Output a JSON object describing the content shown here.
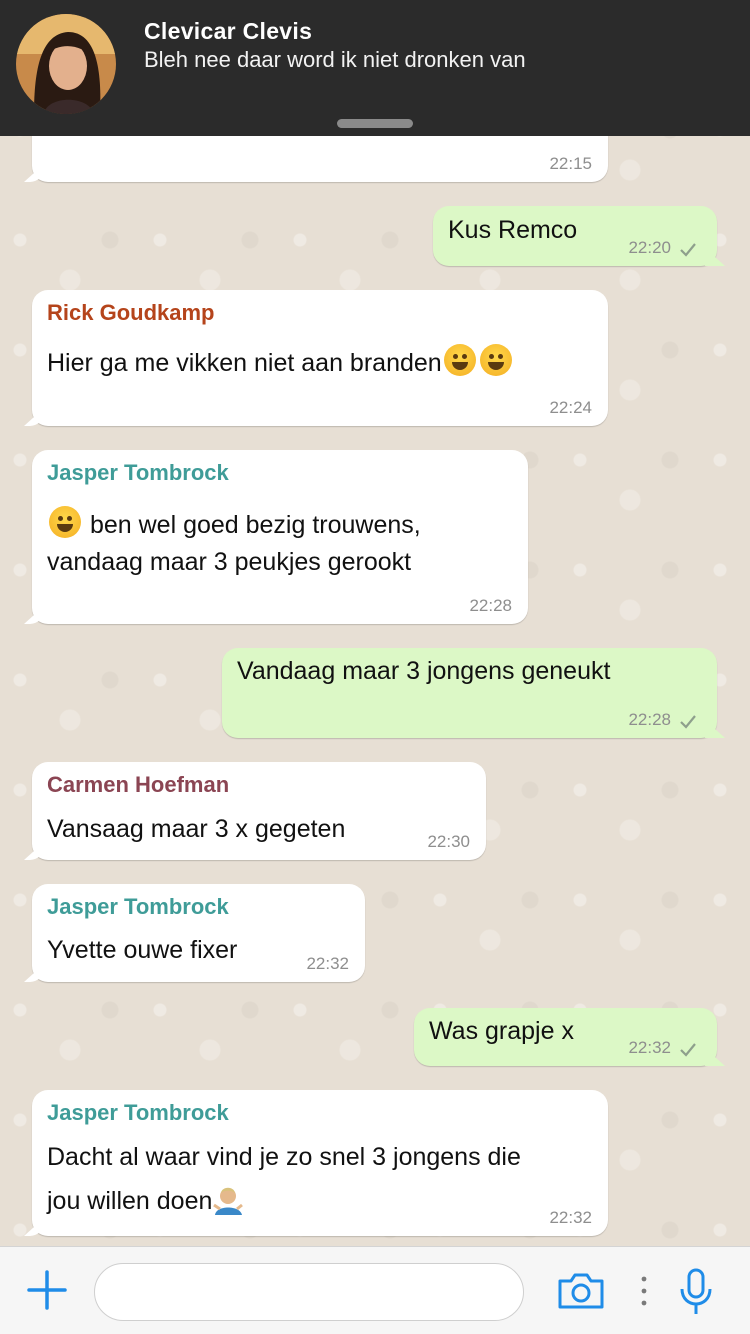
{
  "notification": {
    "sender": "Clevicar Clevis",
    "preview": "Bleh nee daar word ik niet dronken van"
  },
  "messages": [
    {
      "dir": "in",
      "sender": "",
      "text": "",
      "time": "22:15"
    },
    {
      "dir": "out",
      "text": "Kus Remco",
      "time": "22:20"
    },
    {
      "dir": "in",
      "sender": "Rick Goudkamp",
      "sender_color": "#b5441b",
      "text": "Hier ga me vikken niet aan branden",
      "time": "22:24"
    },
    {
      "dir": "in",
      "sender": "Jasper Tombrock",
      "sender_color": "#3f9c98",
      "text_line1": "ben wel goed bezig trouwens,",
      "text_line2": "vandaag maar 3 peukjes gerookt",
      "time": "22:28"
    },
    {
      "dir": "out",
      "text": "Vandaag maar 3 jongens geneukt",
      "time": "22:28"
    },
    {
      "dir": "in",
      "sender": "Carmen Hoefman",
      "sender_color": "#8b4553",
      "text": "Vansaag maar 3 x gegeten",
      "time": "22:30"
    },
    {
      "dir": "in",
      "sender": "Jasper Tombrock",
      "sender_color": "#3f9c98",
      "text": "Yvette ouwe fixer",
      "time": "22:32"
    },
    {
      "dir": "out",
      "text": "Was grapje x",
      "time": "22:32"
    },
    {
      "dir": "in",
      "sender": "Jasper Tombrock",
      "sender_color": "#3f9c98",
      "text_line1": "Dacht al waar vind je zo snel 3 jongens die",
      "text_line2": "jou willen doen",
      "time": "22:32"
    }
  ],
  "colors": {
    "outgoing_bubble": "#dcf8c6",
    "incoming_bubble": "#ffffff",
    "accent": "#1f8ce8"
  },
  "icons": [
    "plus-icon",
    "camera-icon",
    "more-dots-icon",
    "microphone-icon",
    "read-tick-icon"
  ]
}
